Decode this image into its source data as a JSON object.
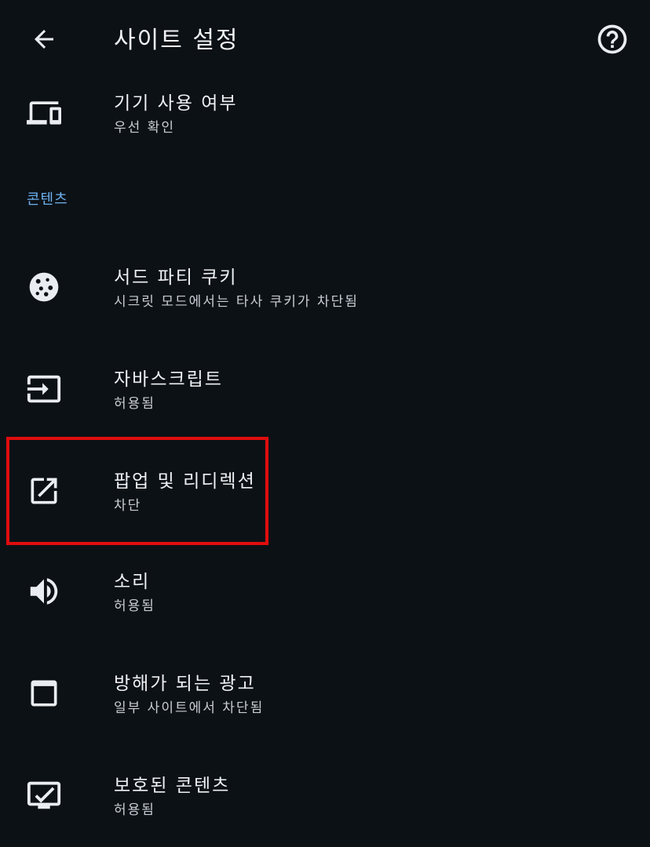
{
  "header": {
    "title": "사이트 설정",
    "back_icon": "arrow-left-icon",
    "help_icon": "help-circle-icon"
  },
  "section": {
    "title": "콘텐츠"
  },
  "items": [
    {
      "key": "device-usage",
      "label": "기기 사용 여부",
      "sub": "우선 확인",
      "icon": "devices-icon"
    },
    {
      "key": "third-party-cookies",
      "label": "서드 파티 쿠키",
      "sub": "시크릿 모드에서는 타사 쿠키가 차단됨",
      "icon": "cookie-icon"
    },
    {
      "key": "javascript",
      "label": "자바스크립트",
      "sub": "허용됨",
      "icon": "input-arrow-icon"
    },
    {
      "key": "popups",
      "label": "팝업 및 리디렉션",
      "sub": "차단",
      "icon": "open-in-new-icon"
    },
    {
      "key": "sound",
      "label": "소리",
      "sub": "허용됨",
      "icon": "volume-icon"
    },
    {
      "key": "intrusive-ads",
      "label": "방해가 되는 광고",
      "sub": "일부 사이트에서 차단됨",
      "icon": "window-icon"
    },
    {
      "key": "protected-content",
      "label": "보호된 콘텐츠",
      "sub": "허용됨",
      "icon": "monitor-check-icon"
    }
  ],
  "colors": {
    "background": "#0c1116",
    "section_header": "#6fb3f2",
    "highlight_border": "#e00d0d"
  }
}
